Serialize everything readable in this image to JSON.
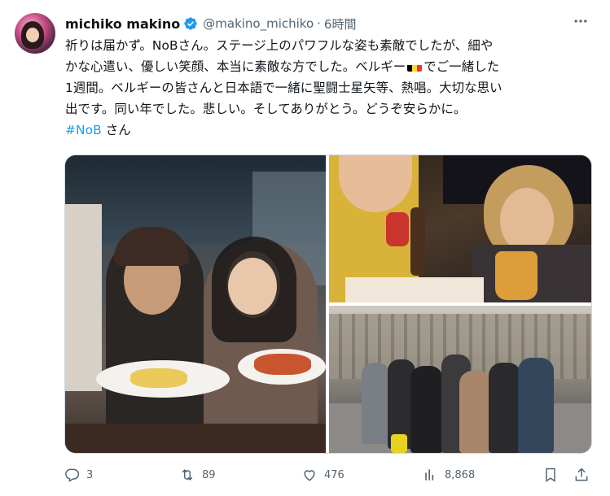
{
  "tweet": {
    "author_name": "michiko makino",
    "handle": "@makino_michiko",
    "separator": "·",
    "time": "6時間",
    "lines": [
      "祈りは届かず。NoBさん。ステージ上のパワフルな姿も素敵でしたが、細や",
      "かな心遣い、優しい笑顔、本当に素敵な方でした。ベルギー",
      "でご一緒した",
      "1週間。ベルギーの皆さんと日本語で一緒に聖闘士星矢等、熱唱。大切な思い",
      "出です。同い年でした。悲しい。そしてありがとう。どうぞ安らかに。"
    ],
    "hashtag": "#NoB",
    "hashtag_suffix": " さん"
  },
  "icons": {
    "verified": "verified-badge-icon",
    "more": "more-options-icon",
    "reply": "reply-icon",
    "retweet": "retweet-icon",
    "like": "like-icon",
    "views": "views-icon",
    "bookmark": "bookmark-icon",
    "share": "share-icon",
    "flag": "belgium-flag-icon"
  },
  "actions": {
    "replies": "3",
    "retweets": "89",
    "likes": "476",
    "views": "8,868"
  },
  "colors": {
    "accent": "#1d9bf0",
    "muted": "#536471",
    "text": "#0f1419",
    "flag_black": "#000000",
    "flag_yellow": "#fdda24",
    "flag_red": "#ef3340"
  }
}
